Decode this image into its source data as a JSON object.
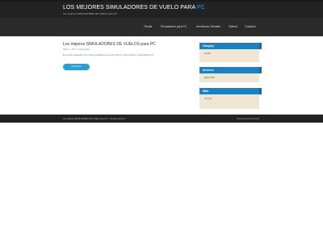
{
  "site": {
    "title_main": "LOS MEJORES SIMULADORES DE VUELO PARA ",
    "title_accent": "PC",
    "description": "Los mejores SIMULADORES DE VUELO para PC"
  },
  "nav": {
    "items": [
      "Tienda",
      "Simuladores para PC",
      "Aerolineas Virtuales",
      "Galeria",
      "Contacto"
    ]
  },
  "post": {
    "title": "Los mejores SIMULADORES DE VUELOS para PC",
    "date": "Marzo 6, 2017",
    "comments": "1 Comentario",
    "excerpt": "Es una lista realizada en los mejores simuladores de vuelos para PC, recomendamos y desarrollamos los",
    "read_more": "read more"
  },
  "sidebar": {
    "category": {
      "title": "Category",
      "items": [
        "Tienda"
      ]
    },
    "archives": {
      "title": "Archives",
      "items": [
        "Marzo 2017"
      ]
    },
    "meta": {
      "title": "Meta",
      "items": [
        "Acceder"
      ]
    }
  },
  "footer": {
    "left": "Los mejores SIMULADORES DE VUELO para PC · All right reserved",
    "right": "Theme by Aruse Themes"
  },
  "colors": {
    "accent": "#2a9fd6",
    "header_bg": "#222222",
    "widget_bg": "#f0e6d3",
    "widget_title_bg": "#1f7fbf"
  }
}
